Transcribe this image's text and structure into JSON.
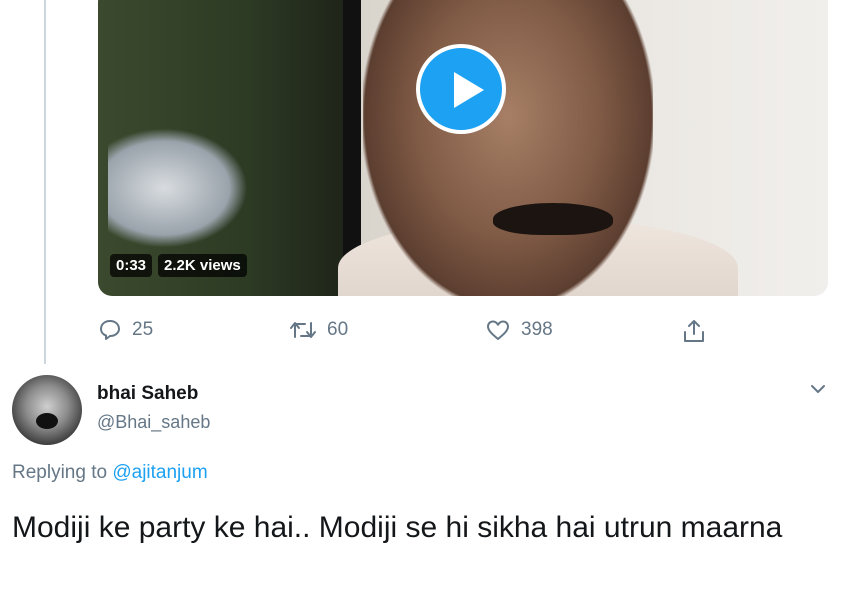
{
  "video": {
    "duration": "0:33",
    "views": "2.2K views",
    "play_icon": "play-icon"
  },
  "actions": {
    "replies": "25",
    "retweets": "60",
    "likes": "398",
    "icons": [
      "reply-icon",
      "retweet-icon",
      "like-icon",
      "share-icon"
    ]
  },
  "reply_tweet": {
    "display_name": "bhai Saheb",
    "handle": "@Bhai_saheb",
    "replying_prefix": "Replying to",
    "replying_to": "@ajitanjum",
    "text": "Modiji ke party ke hai.. Modiji se hi sikha hai utrun maarna"
  },
  "colors": {
    "accent": "#1da1f2",
    "muted": "#657786",
    "text": "#14171a",
    "thread_line": "#ccd6dd"
  }
}
